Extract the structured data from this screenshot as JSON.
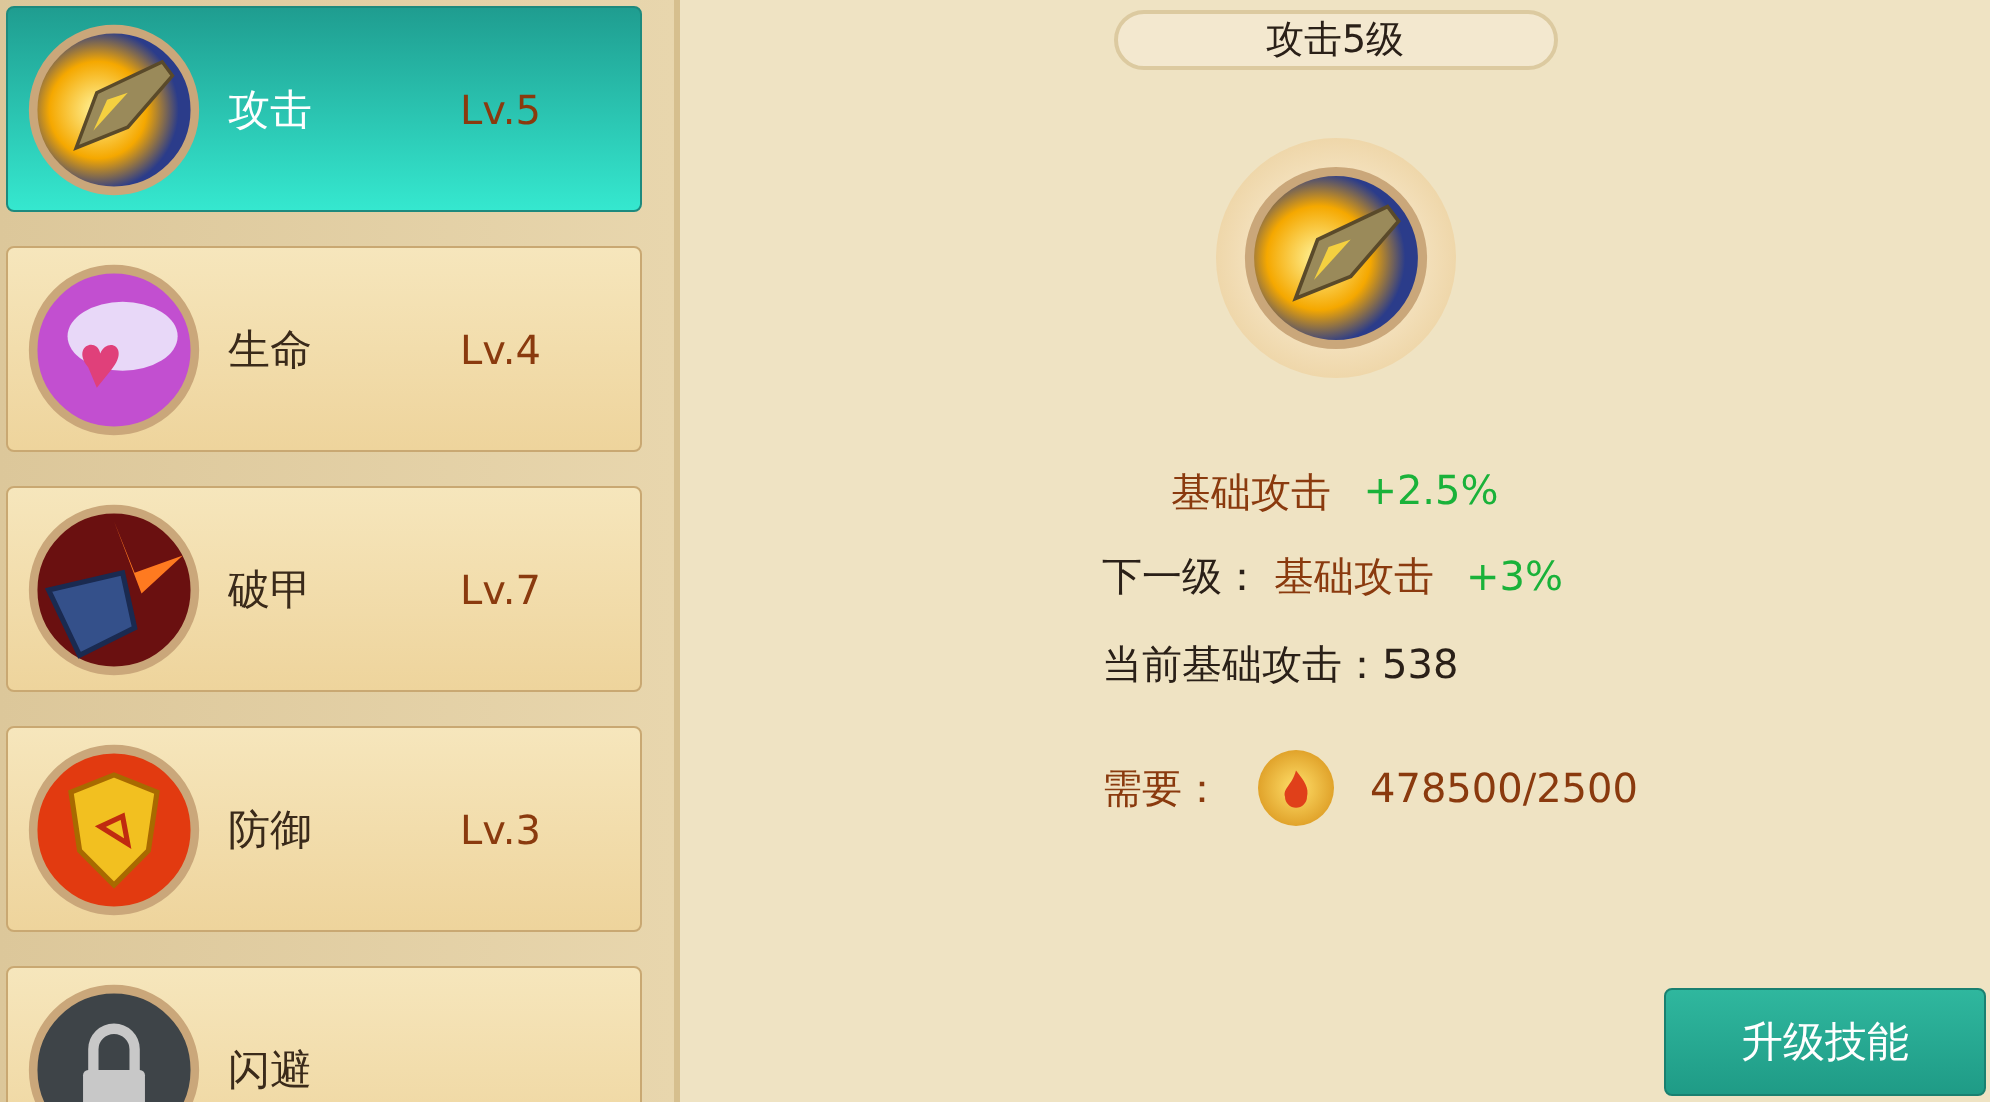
{
  "skills": [
    {
      "kind": "sword",
      "name": "攻击",
      "level": "Lv.5",
      "selected": true
    },
    {
      "kind": "heart",
      "name": "生命",
      "level": "Lv.4",
      "selected": false
    },
    {
      "kind": "armor",
      "name": "破甲",
      "level": "Lv.7",
      "selected": false
    },
    {
      "kind": "shield",
      "name": "防御",
      "level": "Lv.3",
      "selected": false
    },
    {
      "kind": "locked",
      "name": "闪避",
      "selected": false
    }
  ],
  "detail": {
    "title": "攻击5级",
    "current_bonus": {
      "stat": "基础攻击",
      "value": "+2.5%"
    },
    "next_level": {
      "label": "下一级：",
      "stat": "基础攻击",
      "value": "+3%"
    },
    "current_stat": "当前基础攻击：538",
    "cost": {
      "label": "需要：",
      "amount": "478500/2500"
    }
  },
  "upgrade_button": "升级技能"
}
